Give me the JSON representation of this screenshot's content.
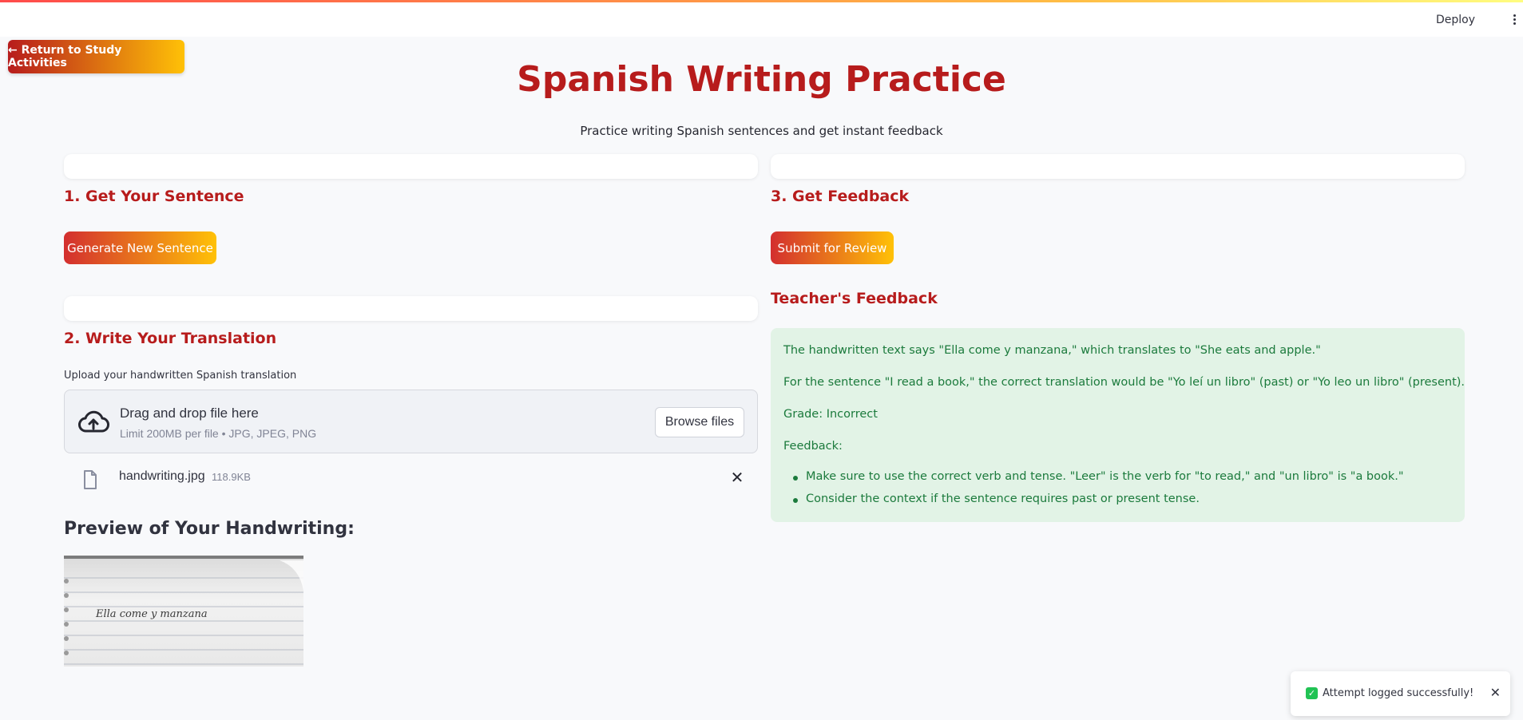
{
  "topbar": {
    "deploy_label": "Deploy",
    "menu_icon": "kebab-menu-icon"
  },
  "nav": {
    "return_label": "← Return to Study Activities"
  },
  "page": {
    "title": "Spanish Writing Practice",
    "subtitle": "Practice writing Spanish sentences and get instant feedback"
  },
  "step1": {
    "heading": "1. Get Your Sentence",
    "button_label": "Generate New Sentence"
  },
  "step2": {
    "heading": "2. Write Your Translation",
    "upload_label": "Upload your handwritten Spanish translation",
    "dropzone_title": "Drag and drop file here",
    "dropzone_limit": "Limit 200MB per file • JPG, JPEG, PNG",
    "browse_label": "Browse files",
    "file": {
      "name": "handwriting.jpg",
      "size": "118.9KB",
      "remove_glyph": "✕"
    },
    "preview_heading": "Preview of Your Handwriting:",
    "preview_handwriting": "Ella come y manzana"
  },
  "step3": {
    "heading": "3. Get Feedback",
    "button_label": "Submit for Review",
    "teacher_heading": "Teacher's Feedback",
    "feedback": {
      "line1": "The handwritten text says \"Ella come y manzana,\" which translates to \"She eats and apple.\"",
      "line2": "For the sentence \"I read a book,\" the correct translation would be \"Yo leí un libro\" (past) or \"Yo leo un libro\" (present).",
      "grade": "Grade: Incorrect",
      "feedback_label": "Feedback:",
      "bullets": [
        "Make sure to use the correct verb and tense. \"Leer\" is the verb for \"to read,\" and \"un libro\" is \"a book.\"",
        "Consider the context if the sentence requires past or present tense."
      ]
    }
  },
  "toast": {
    "message": "Attempt logged successfully!",
    "close_glyph": "✕"
  },
  "colors": {
    "accent": "#b71c1c",
    "feedback_bg": "#e2f3e6",
    "feedback_text": "#1b7a3c",
    "success": "#21c354"
  }
}
